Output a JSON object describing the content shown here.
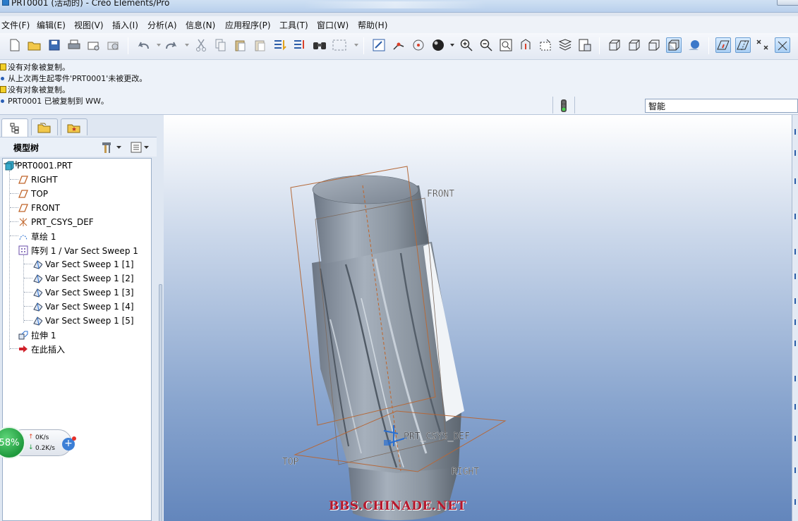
{
  "window": {
    "title": "PRT0001 (活动的) - Creo Elements/Pro"
  },
  "menubar": {
    "items": [
      "文件(F)",
      "编辑(E)",
      "视图(V)",
      "插入(I)",
      "分析(A)",
      "信息(N)",
      "应用程序(P)",
      "工具(T)",
      "窗口(W)",
      "帮助(H)"
    ]
  },
  "messages": [
    {
      "icon": "warning-icon",
      "text": "没有对象被复制。"
    },
    {
      "icon": "bullet-icon",
      "text": "从上次再生起零件'PRT0001'未被更改。"
    },
    {
      "icon": "warning-icon",
      "text": "没有对象被复制。"
    },
    {
      "icon": "bullet-icon",
      "text": "PRT0001 已被复制到 WW。"
    }
  ],
  "filter": {
    "value": "智能"
  },
  "navigator": {
    "header": "模型树",
    "tree": [
      {
        "label": "PRT0001.PRT",
        "icon": "part-icon",
        "level": 0
      },
      {
        "label": "RIGHT",
        "icon": "datum-plane-icon",
        "level": 1
      },
      {
        "label": "TOP",
        "icon": "datum-plane-icon",
        "level": 1
      },
      {
        "label": "FRONT",
        "icon": "datum-plane-icon",
        "level": 1
      },
      {
        "label": "PRT_CSYS_DEF",
        "icon": "csys-icon",
        "level": 1
      },
      {
        "label": "草绘 1",
        "icon": "sketch-icon",
        "level": 1
      },
      {
        "label": "阵列 1 / Var Sect Sweep 1",
        "icon": "pattern-icon",
        "level": 1,
        "expanded": true
      },
      {
        "label": "Var Sect Sweep 1 [1]",
        "icon": "sweep-icon",
        "level": 2
      },
      {
        "label": "Var Sect Sweep 1 [2]",
        "icon": "sweep-icon",
        "level": 2
      },
      {
        "label": "Var Sect Sweep 1 [3]",
        "icon": "sweep-icon",
        "level": 2
      },
      {
        "label": "Var Sect Sweep 1 [4]",
        "icon": "sweep-icon",
        "level": 2
      },
      {
        "label": "Var Sect Sweep 1 [5]",
        "icon": "sweep-icon",
        "level": 2
      },
      {
        "label": "拉伸 1",
        "icon": "extrude-icon",
        "level": 1,
        "expanded": false
      },
      {
        "label": "在此插入",
        "icon": "insert-arrow-icon",
        "level": 1
      }
    ]
  },
  "speed_widget": {
    "percent": "58%",
    "up": "0K/s",
    "down": "0.2K/s"
  },
  "viewport": {
    "datum_labels": {
      "front": "FRONT",
      "top": "TOP",
      "right": "RIGHT",
      "csys": "PRT_CSYS_DEF"
    },
    "watermark": "BBS.CHINADE.NET"
  },
  "colors": {
    "datum_plane_frame": "#c0652a",
    "watermark": "#b7182c",
    "csys": "#2a6fd1"
  }
}
